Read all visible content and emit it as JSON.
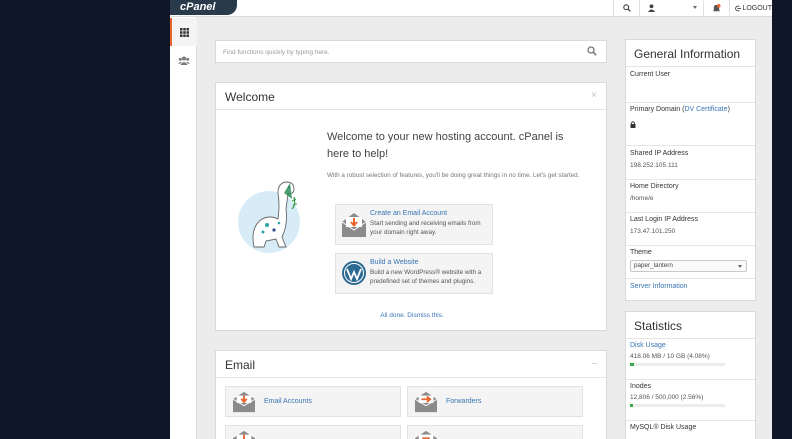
{
  "topbar": {
    "logo": "cPanel",
    "logout_label": "LOGOUT"
  },
  "search": {
    "placeholder": "Find functions quickly by typing here."
  },
  "welcome": {
    "title": "Welcome",
    "heading": "Welcome to your new hosting account. cPanel is here to help!",
    "subtext": "With a robust selection of features, you'll be doing great things in no time. Let's get started.",
    "actions": [
      {
        "title": "Create an Email Account",
        "desc": "Start sending and receiving emails from your domain right away."
      },
      {
        "title": "Build a Website",
        "desc": "Build a new WordPress® website with a predefined set of themes and plugins."
      }
    ],
    "dismiss": "All done. Dismiss this."
  },
  "email": {
    "title": "Email",
    "items": [
      {
        "label": "Email Accounts"
      },
      {
        "label": "Forwarders"
      }
    ]
  },
  "general_info": {
    "title": "General Information",
    "current_user_label": "Current User",
    "primary_domain_label": "Primary Domain (",
    "primary_domain_link": "DV Certificate",
    "primary_domain_close": ")",
    "shared_ip_label": "Shared IP Address",
    "shared_ip_value": "198.252.105.111",
    "home_dir_label": "Home Directory",
    "home_dir_value": "/home/e",
    "last_login_label": "Last Login IP Address",
    "last_login_value": "173.47.101.250",
    "theme_label": "Theme",
    "theme_value": "paper_lantern",
    "server_info_link": "Server Information"
  },
  "statistics": {
    "title": "Statistics",
    "rows": [
      {
        "label": "Disk Usage",
        "value": "418.06 MB / 10 GB   (4.08%)",
        "percent": 4.08
      },
      {
        "label": "Inodes",
        "value": "12,806 / 500,000   (2.56%)",
        "percent": 2.56
      },
      {
        "label": "MySQL® Disk Usage"
      }
    ]
  },
  "colors": {
    "accent": "#e8652d",
    "link": "#3874b4",
    "logo_bg": "#293a4a",
    "usage_bar": "#3aa845"
  }
}
